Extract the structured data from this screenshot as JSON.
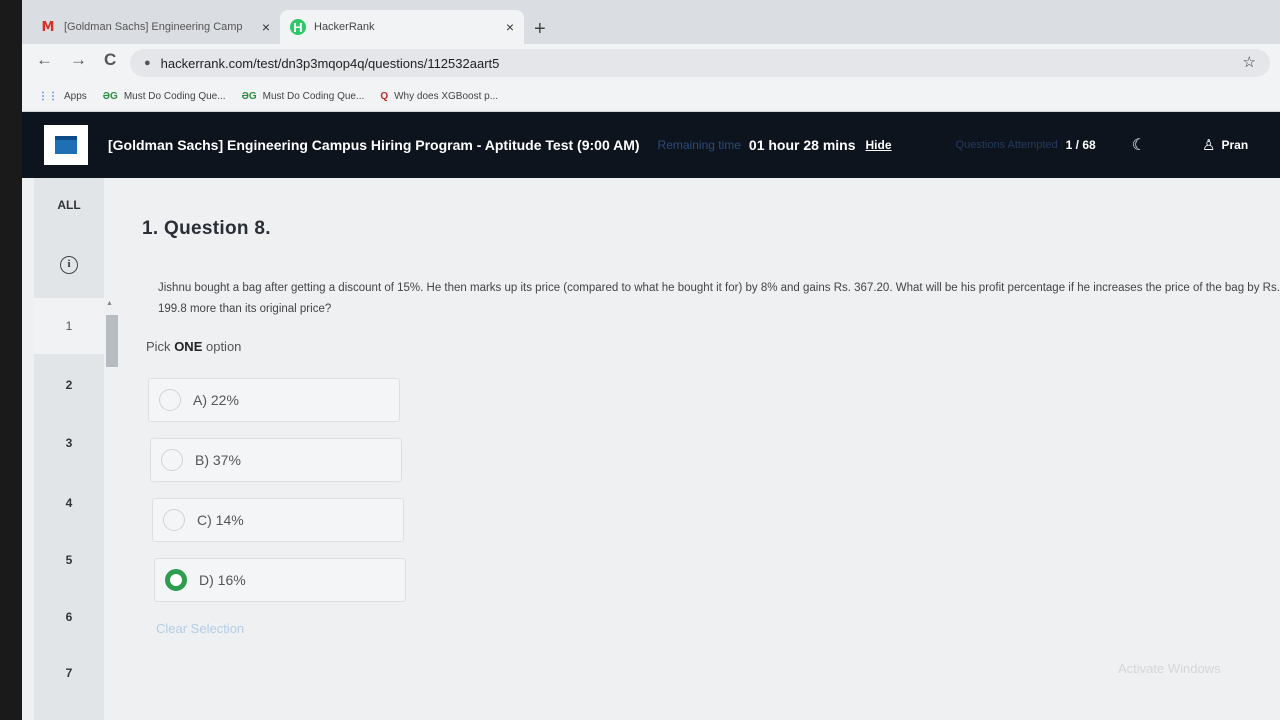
{
  "browser": {
    "tabs": [
      {
        "title": "[Goldman Sachs] Engineering Camp",
        "close": "×",
        "icon": "gmail-icon"
      },
      {
        "title": "HackerRank",
        "close": "×",
        "icon": "hackerrank-icon"
      }
    ],
    "new_tab": "+",
    "nav": {
      "back": "←",
      "forward": "→",
      "reload": "C"
    },
    "url": "hackerrank.com/test/dn3p3mqop4q/questions/112532aart5",
    "bookmarks": [
      {
        "label": "Apps",
        "icon": "apps-icon",
        "glyph": "⋮⋮"
      },
      {
        "label": "Must Do Coding Que...",
        "icon": "gfg-icon",
        "glyph": "ƏG"
      },
      {
        "label": "Must Do Coding Que...",
        "icon": "gfg-icon",
        "glyph": "ƏG"
      },
      {
        "label": "Why does XGBoost p...",
        "icon": "quora-icon",
        "glyph": "Q"
      }
    ]
  },
  "header": {
    "title": "[Goldman Sachs] Engineering Campus Hiring Program - Aptitude Test (9:00 AM)",
    "remaining_label": "Remaining time",
    "remaining_value": "01 hour 28 mins",
    "hide": "Hide",
    "attempted_label": "Questions Attempted",
    "attempted_value": "1 / 68",
    "user": "Pran"
  },
  "sidebar": {
    "all": "ALL",
    "items": [
      "1",
      "2",
      "3",
      "4",
      "5",
      "6",
      "7"
    ]
  },
  "question": {
    "title": "1. Question 8.",
    "text": "Jishnu bought a bag after getting a discount of 15%. He then marks up its price (compared to what he bought it for) by 8% and gains Rs. 367.20. What will be his profit percentage if he increases the price of the bag by Rs. 199.8 more than its original price?",
    "pick_prefix": "Pick",
    "pick_bold": "ONE",
    "pick_suffix": "option",
    "options": [
      "A) 22%",
      "B) 37%",
      "C) 14%",
      "D) 16%"
    ],
    "selected_index": 3,
    "clear": "Clear Selection"
  },
  "watermark": "Activate Windows",
  "colors": {
    "header_bg": "#0e141e",
    "selected_radio": "#2e9d4f",
    "clear_link": "#b5cde6"
  }
}
